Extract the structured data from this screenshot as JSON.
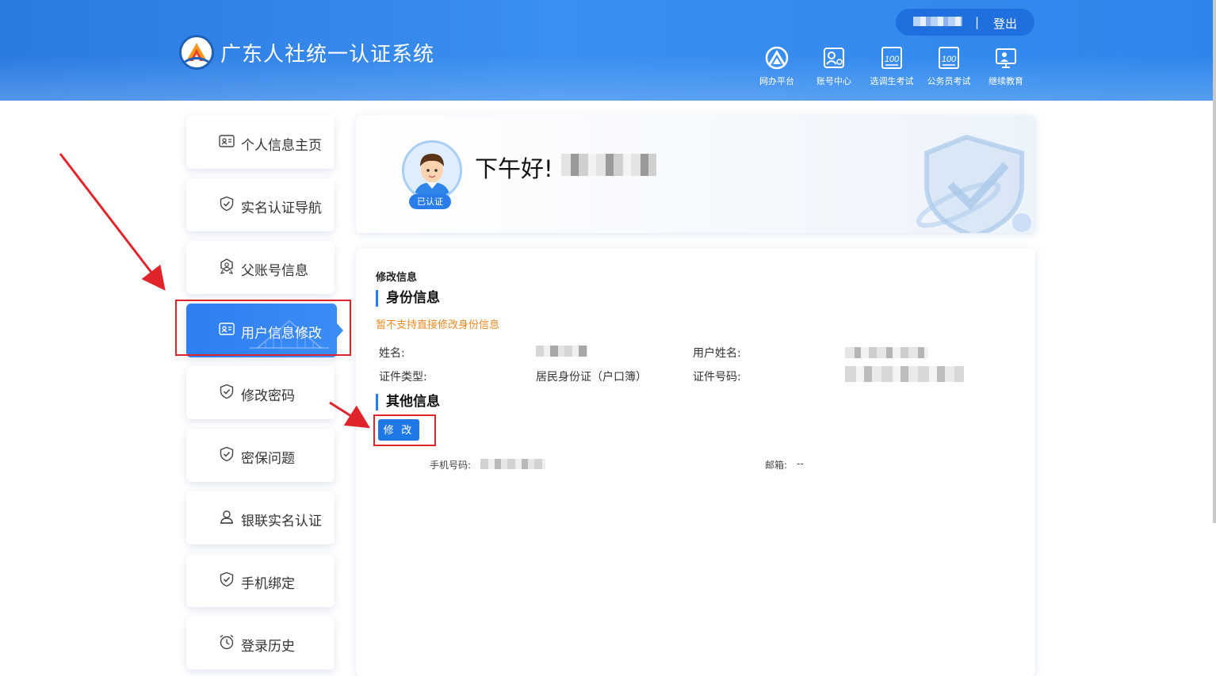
{
  "header": {
    "app_title": "广东人社统一认证系统",
    "logout": "登出",
    "separator": "|",
    "nav": [
      {
        "label": "网办平台",
        "icon": "portal-icon"
      },
      {
        "label": "账号中心",
        "icon": "account-center-icon"
      },
      {
        "label": "选调生考试",
        "icon": "exam-100-icon"
      },
      {
        "label": "公务员考试",
        "icon": "exam-100-icon"
      },
      {
        "label": "继续教育",
        "icon": "education-icon"
      }
    ]
  },
  "sidebar": {
    "items": [
      {
        "label": "个人信息主页",
        "icon": "id-card-icon"
      },
      {
        "label": "实名认证导航",
        "icon": "shield-check-icon"
      },
      {
        "label": "父账号信息",
        "icon": "badge-icon"
      },
      {
        "label": "用户信息修改",
        "icon": "id-card-icon",
        "active": true
      },
      {
        "label": "修改密码",
        "icon": "shield-check-icon"
      },
      {
        "label": "密保问题",
        "icon": "shield-check-icon"
      },
      {
        "label": "银联实名认证",
        "icon": "user-icon"
      },
      {
        "label": "手机绑定",
        "icon": "shield-check-icon"
      },
      {
        "label": "登录历史",
        "icon": "clock-icon"
      }
    ]
  },
  "welcome": {
    "greeting": "下午好!",
    "verified_badge": "已认证"
  },
  "info": {
    "heading": "修改信息",
    "identity_section": "身份信息",
    "identity_warning": "暂不支持直接修改身份信息",
    "name_label": "姓名:",
    "username_label": "用户姓名:",
    "id_type_label": "证件类型:",
    "id_type_value": "居民身份证（户口簿）",
    "id_number_label": "证件号码:",
    "other_section": "其他信息",
    "edit_button": "修 改",
    "phone_label": "手机号码:",
    "email_label": "邮箱:",
    "email_value": "--"
  },
  "colors": {
    "header_blue": "#2f86ea",
    "accent_blue": "#2a7de8",
    "warning_orange": "#f08a24",
    "annotation_red": "#e0242c"
  }
}
